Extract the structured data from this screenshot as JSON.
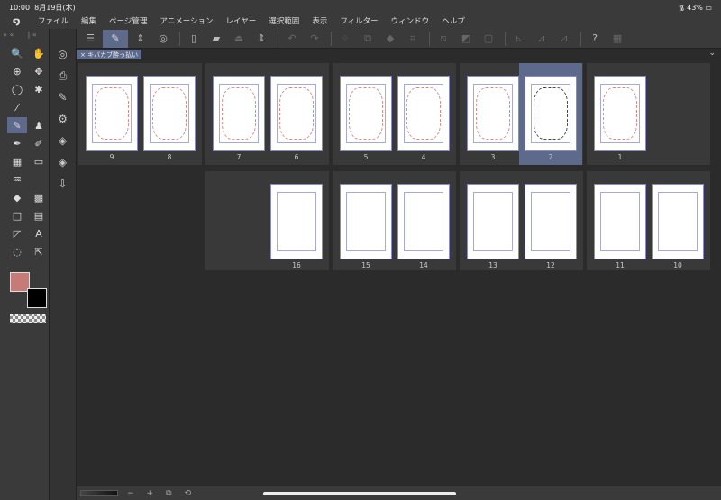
{
  "status": {
    "time": "10:00",
    "date": "8月19日(木)",
    "battery": "43%"
  },
  "menu": [
    "ファイル",
    "編集",
    "ページ管理",
    "アニメーション",
    "レイヤー",
    "選択範囲",
    "表示",
    "フィルター",
    "ウィンドウ",
    "ヘルプ"
  ],
  "tab": {
    "label": "キバカブ酔っ払い",
    "close": "×"
  },
  "tools": [
    "🔍",
    "✋",
    "⊕",
    "✥",
    "◯",
    "✱",
    "⁄",
    "",
    "✎",
    "♟",
    "✒",
    "✐",
    "▦",
    "▭",
    "♒",
    "",
    "◆",
    "▩",
    "□",
    "▤",
    "◸",
    "A",
    "◌",
    "⇱"
  ],
  "row1": [
    [
      "9",
      "8"
    ],
    [
      "7",
      "6"
    ],
    [
      "5",
      "4"
    ],
    [
      "3",
      "2"
    ],
    [
      "1"
    ]
  ],
  "row2": [
    [
      "",
      "16"
    ],
    [
      "15",
      "14"
    ],
    [
      "13",
      "12"
    ],
    [
      "11",
      "10"
    ]
  ],
  "selected_page": "2",
  "ink_pages": [
    "2"
  ],
  "blank_pages": [
    "16",
    "15",
    "14",
    "13",
    "12",
    "11",
    "10"
  ],
  "bottom": {
    "minus": "−",
    "plus": "+"
  },
  "colors": {
    "main": "#c77b78",
    "sub": "#000000",
    "accent": "#5d6a8c"
  }
}
